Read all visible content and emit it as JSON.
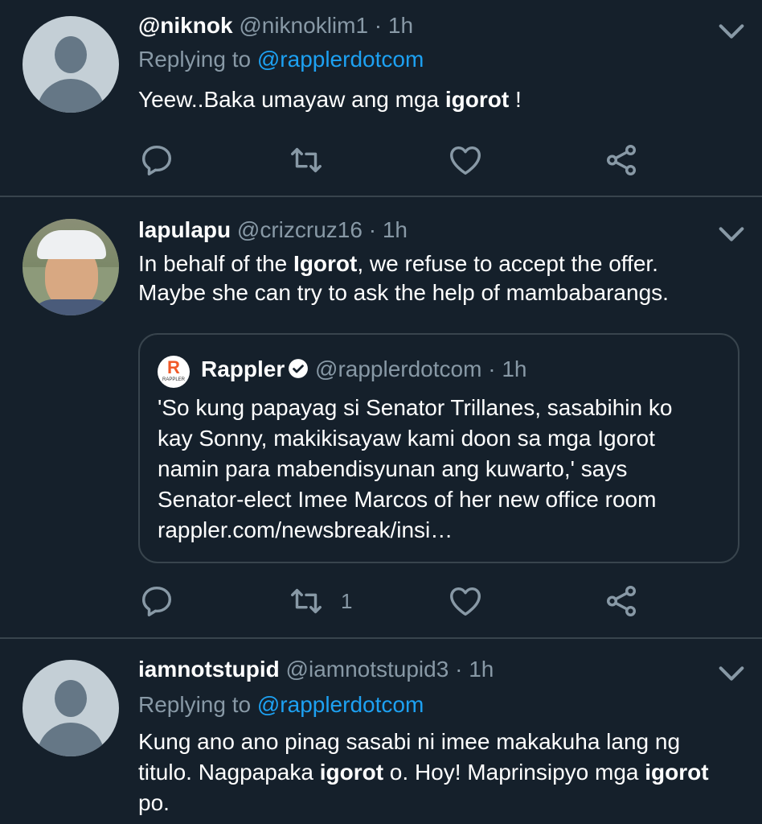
{
  "tweets": [
    {
      "name": "@niknok",
      "handle": "@niknoklim1",
      "time": "1h",
      "replying_label": "Replying to",
      "replying_to": "@rapplerdotcom",
      "text_before": "Yeew..Baka umayaw ang mga ",
      "text_bold": "igorot",
      "text_after": " !"
    },
    {
      "name": "lapulapu",
      "handle": "@crizcruz16",
      "time": "1h",
      "line1_before": "In behalf of the ",
      "line1_bold": "Igorot",
      "line1_after": ", we refuse to accept the offer.",
      "line2": "Maybe she can try to ask the help of mambabarangs.",
      "retweet_count": "1",
      "quote": {
        "logo_letter": "R",
        "logo_text": "RAPPLER",
        "name": "Rappler",
        "handle": "@rapplerdotcom",
        "time": "1h",
        "lines": [
          "'So kung papayag si Senator Trillanes, sasabihin ko",
          "kay Sonny, makikisayaw kami doon sa mga Igorot",
          "namin para mabendisyunan ang kuwarto,' says",
          "Senator-elect Imee Marcos of her new office room",
          "rappler.com/newsbreak/insi…"
        ]
      }
    },
    {
      "name": "iamnotstupid",
      "handle": "@iamnotstupid3",
      "time": "1h",
      "replying_label": "Replying to",
      "replying_to": "@rapplerdotcom",
      "line1": "Kung ano ano pinag sasabi ni imee makakuha lang ng",
      "line2_a": "titulo. Nagpapaka ",
      "line2_b": "igorot",
      "line2_c": " o. Hoy! Maprinsipyo mga ",
      "line2_d": "igorot",
      "line3": "po."
    }
  ],
  "separator": " · ",
  "icons": {
    "reply": "reply-icon",
    "retweet": "retweet-icon",
    "like": "heart-icon",
    "share": "share-icon",
    "more": "chevron-down-icon",
    "verified": "verified-badge-icon"
  },
  "colors": {
    "background": "#15202b",
    "muted": "#8899a6",
    "link": "#1da1f2",
    "divider": "#38444d"
  }
}
